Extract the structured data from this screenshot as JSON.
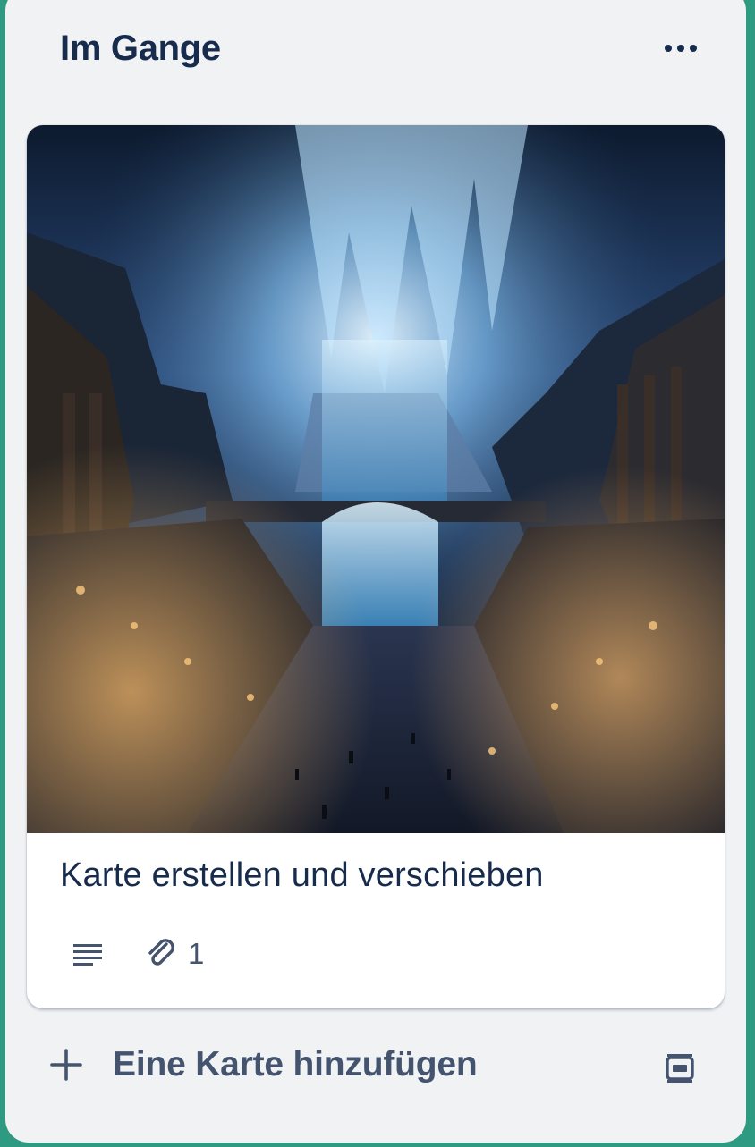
{
  "list": {
    "title": "Im Gange",
    "menu_icon": "more-horizontal-icon"
  },
  "card": {
    "cover_description": "cover-image",
    "title": "Karte erstellen und verschieben",
    "description_icon": "description-icon",
    "attachment_icon": "paperclip-icon",
    "attachment_count": "1"
  },
  "footer": {
    "add_icon": "plus-icon",
    "add_label": "Eine Karte hinzufügen",
    "template_icon": "card-template-icon"
  },
  "colors": {
    "board_background": "#2f9a82",
    "list_background": "#f1f2f4",
    "card_background": "#ffffff",
    "text_primary": "#172b4d",
    "text_secondary": "#44546f"
  }
}
